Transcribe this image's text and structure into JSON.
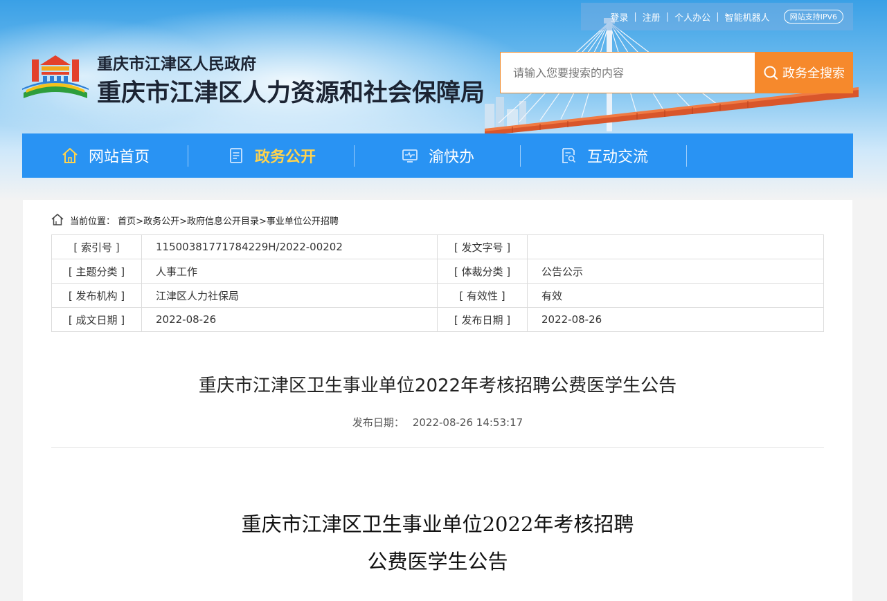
{
  "colors": {
    "nav_bg": "#2993f3",
    "nav_active": "#ffd34d",
    "search_button": "#f6892c",
    "search_border": "#f08a2a"
  },
  "toplinks": {
    "items": [
      "登录",
      "注册",
      "个人办公",
      "智能机器人"
    ],
    "ipv6_badge": "网站支持IPV6"
  },
  "header": {
    "logo_icon": "government-building-logo",
    "title_small": "重庆市江津区人民政府",
    "title_big": "重庆市江津区人力资源和社会保障局"
  },
  "search": {
    "placeholder": "请输入您要搜索的内容",
    "button_label": "政务全搜索",
    "button_icon": "search-icon"
  },
  "nav": {
    "items": [
      {
        "label": "网站首页",
        "icon": "home-icon",
        "active": false
      },
      {
        "label": "政务公开",
        "icon": "document-icon",
        "active": true
      },
      {
        "label": "渝快办",
        "icon": "monitor-icon",
        "active": false
      },
      {
        "label": "互动交流",
        "icon": "chat-search-icon",
        "active": false
      }
    ]
  },
  "breadcrumb": {
    "icon": "home-outline-icon",
    "label": "当前位置：",
    "items": [
      "首页",
      "政务公开",
      "政府信息公开目录",
      "事业单位公开招聘"
    ],
    "separator": ">"
  },
  "meta_table": {
    "rows": [
      {
        "k1": "[ 索引号 ]",
        "v1": "11500381771784229H/2022-00202",
        "k2": "[ 发文字号 ]",
        "v2": ""
      },
      {
        "k1": "[ 主题分类 ]",
        "v1": "人事工作",
        "k2": "[ 体裁分类 ]",
        "v2": "公告公示"
      },
      {
        "k1": "[ 发布机构 ]",
        "v1": "江津区人力社保局",
        "k2": "[ 有效性 ]",
        "v2": "有效"
      },
      {
        "k1": "[ 成文日期 ]",
        "v1": "2022-08-26",
        "k2": "[ 发布日期 ]",
        "v2": "2022-08-26"
      }
    ]
  },
  "article": {
    "title": "重庆市江津区卫生事业单位2022年考核招聘公费医学生公告",
    "date_label": "发布日期：",
    "date_value": "2022-08-26 14:53:17",
    "body_title_line1": "重庆市江津区卫生事业单位2022年考核招聘",
    "body_title_line2": "公费医学生公告"
  }
}
